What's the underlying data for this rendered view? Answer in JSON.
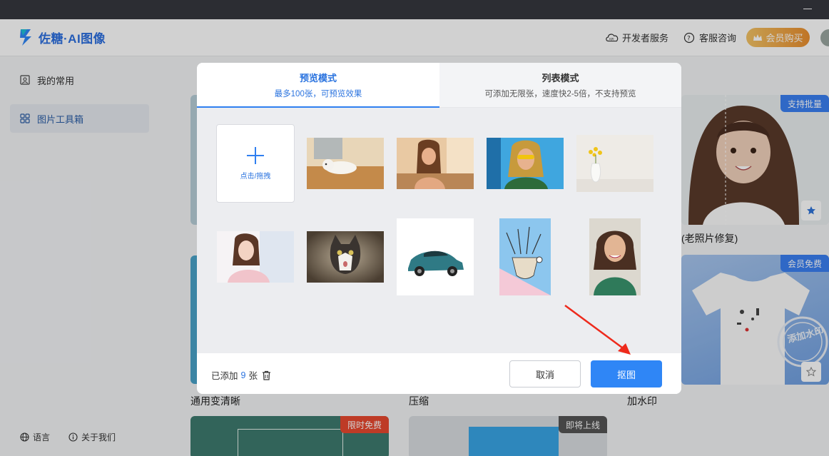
{
  "app": {
    "title_prefix": "佐糖",
    "title_suffix": "·AI图像"
  },
  "header": {
    "developer": "开发者服务",
    "support": "客服咨询",
    "vip": "会员购买"
  },
  "sidebar": {
    "items": [
      {
        "label": "我的常用"
      },
      {
        "label": "图片工具箱"
      }
    ],
    "language": "语言",
    "about": "关于我们"
  },
  "content": {
    "cards": [
      {
        "label": "(老照片修复)",
        "badge": "支持批量"
      },
      {
        "label": "加水印",
        "badge": "会员免费",
        "watermark": "添加水印"
      },
      {
        "label": "通用变清晰"
      },
      {
        "label": "压缩"
      },
      {
        "badge": "限时免费"
      },
      {
        "badge": "即将上线"
      }
    ]
  },
  "modal": {
    "tabs": [
      {
        "title": "预览模式",
        "desc": "最多100张，可预览效果",
        "active": true
      },
      {
        "title": "列表模式",
        "desc": "可添加无限张，速度快2-5倍，不支持预览",
        "active": false
      }
    ],
    "add_tile_label": "点击/拖拽",
    "footer": {
      "added_prefix": "已添加",
      "added_count": "9",
      "added_suffix": "张",
      "cancel": "取消",
      "confirm": "抠图"
    }
  },
  "colors": {
    "accent": "#2f86f6",
    "vip_gradient": [
      "#f3c365",
      "#ea8f2f"
    ],
    "badge_blue": "#3a7ff2",
    "badge_red": "#e8482f",
    "badge_gray": "#555"
  }
}
